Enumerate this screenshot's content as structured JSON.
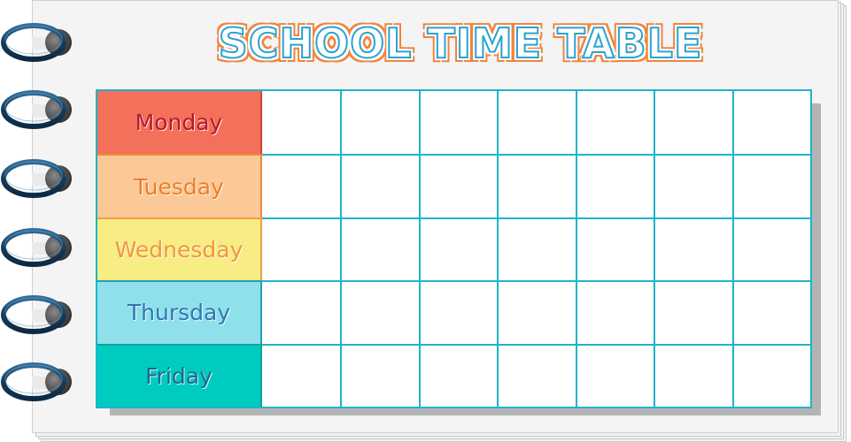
{
  "title": "SCHOOL TIME TABLE",
  "colors": {
    "title_fill": "#ffffff",
    "title_outline": "#2aa3d1",
    "title_border": "#f0843c",
    "grid_line": "#1fb4c9",
    "ring": "#1d4a6e"
  },
  "days": [
    {
      "label": "Monday",
      "bg": "#f3705a",
      "text": "#b5192a",
      "border": "#c9443a"
    },
    {
      "label": "Tuesday",
      "bg": "#fbc998",
      "text": "#ef7d27",
      "border": "#ef8a3a"
    },
    {
      "label": "Wednesday",
      "bg": "#f7ed84",
      "text": "#f2963e",
      "border": "#f0a040"
    },
    {
      "label": "Thursday",
      "bg": "#8ee1ea",
      "text": "#2f77b1",
      "border": "#2a9ab8"
    },
    {
      "label": "Friday",
      "bg": "#00cbbf",
      "text": "#1a6a8e",
      "border": "#11a396"
    }
  ],
  "columns_count": 7,
  "cells": [
    [
      "",
      "",
      "",
      "",
      "",
      "",
      ""
    ],
    [
      "",
      "",
      "",
      "",
      "",
      "",
      ""
    ],
    [
      "",
      "",
      "",
      "",
      "",
      "",
      ""
    ],
    [
      "",
      "",
      "",
      "",
      "",
      "",
      ""
    ],
    [
      "",
      "",
      "",
      "",
      "",
      "",
      ""
    ]
  ],
  "binding_rings": [
    "ring-1",
    "ring-2",
    "ring-3",
    "ring-4",
    "ring-5",
    "ring-6"
  ]
}
